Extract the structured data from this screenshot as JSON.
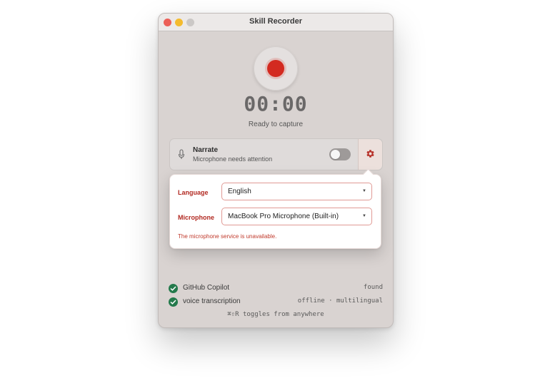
{
  "window": {
    "title": "Skill Recorder"
  },
  "recorder": {
    "timer": "00:00",
    "status": "Ready to capture"
  },
  "narrate": {
    "title": "Narrate",
    "subtitle": "Microphone needs attention",
    "toggle_on": false
  },
  "settings": {
    "language_label": "Language",
    "language_value": "English",
    "microphone_label": "Microphone",
    "microphone_value": "MacBook Pro Microphone (Built-in)",
    "error": "The microphone service is unavailable."
  },
  "checks": [
    {
      "label": "GitHub Copilot",
      "value": "found"
    },
    {
      "label": "voice transcription",
      "value": "offline · multilingual"
    }
  ],
  "shortcut": "⌘⇧R toggles from anywhere",
  "colors": {
    "record": "#d32a20",
    "check": "#247a4c",
    "error": "#c0392b",
    "accent_label": "#b22a22"
  },
  "icons": {
    "microphone": "microphone-icon",
    "settings": "gear-icon",
    "check": "checkmark-icon"
  }
}
